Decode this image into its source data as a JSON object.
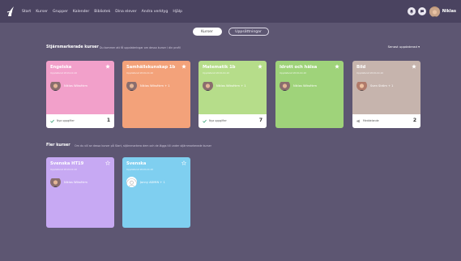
{
  "nav": {
    "items": [
      "Start",
      "Kurser",
      "Grupper",
      "Kalender",
      "Bibliotek",
      "Dina elever",
      "Andra verktyg",
      "Hjälp"
    ],
    "user_name": "Niklas"
  },
  "tabs": {
    "active": "Kurser",
    "inactive": "Uppsättningar"
  },
  "favorites": {
    "title": "Stjärnmarkerade kurser",
    "subtitle": "Du kommer att få uppdateringar om dessa kurser i din profil",
    "sort_label": "Senast uppdaterad ▾"
  },
  "favorite_cards": [
    {
      "name": "Engelska",
      "date": "Uppdaterat 2019-10-10",
      "teacher": "Niklas Wiksétrm",
      "footer_label": "Nya uppgifter",
      "footer_icon": "check-icon",
      "footer_count": "1",
      "color": "#f2a0ca"
    },
    {
      "name": "Samhällskunskap 1b",
      "date": "Uppdaterat 2019-10-10",
      "teacher": "Niklas Wiksétrm + 1",
      "footer_label": "",
      "footer_icon": "",
      "footer_count": "",
      "color": "#f3a27a"
    },
    {
      "name": "Matematik 1b",
      "date": "Uppdaterat 2019-10-10",
      "teacher": "Niklas Wiksétrm + 1",
      "footer_label": "Nya uppgifter",
      "footer_icon": "check-icon",
      "footer_count": "7",
      "color": "#b6dd8a"
    },
    {
      "name": "Idrott och hälsa",
      "date": "Uppdaterat 2019-10-10",
      "teacher": "Niklas Wiksétrm",
      "footer_label": "",
      "footer_icon": "",
      "footer_count": "",
      "color": "#9fd37a"
    },
    {
      "name": "Bild",
      "date": "Uppdaterat 2019-10-10",
      "teacher": "Sven Ström + 1",
      "footer_label": "Meddelande",
      "footer_icon": "megaphone-icon",
      "footer_count": "2",
      "color": "#c6b4ad"
    }
  ],
  "other": {
    "title": "Fler kurser",
    "subtitle": "Om du vill se dessa kurser på Start, stjärnmarkera dem och de läggs till under stjärnmarkerade kurser"
  },
  "other_cards": [
    {
      "name": "Svenska HT19",
      "date": "Uppdaterat 2019-10-10",
      "teacher": "Niklas Wiksétrm",
      "color": "#c7a9f3"
    },
    {
      "name": "Svenska",
      "date": "Uppdaterat 2019-10-10",
      "teacher": "Jonny ADMIN + 1",
      "color": "#7fcff0"
    }
  ]
}
